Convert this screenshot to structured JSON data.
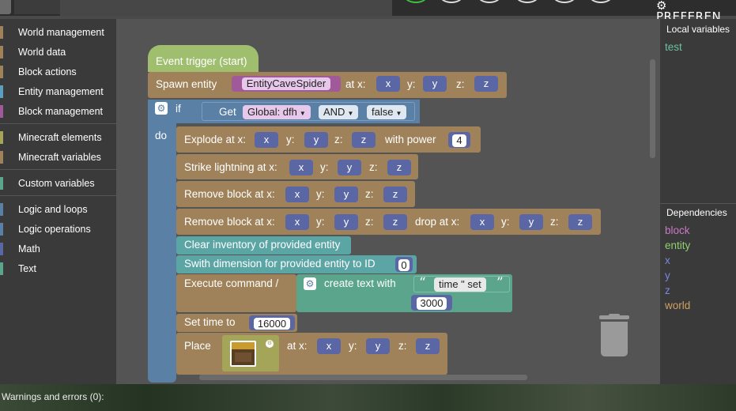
{
  "topbar": {
    "preferences_label": "PREFEREN"
  },
  "palette": {
    "groups": [
      {
        "label": "World management",
        "color": "#a0825a"
      },
      {
        "label": "World data",
        "color": "#a0825a"
      },
      {
        "label": "Block actions",
        "color": "#a0825a"
      },
      {
        "label": "Entity management",
        "color": "#5b9fbf"
      },
      {
        "label": "Block management",
        "color": "#a05a9a"
      },
      {
        "label": "Minecraft elements",
        "color": "#a5a55a"
      },
      {
        "label": "Minecraft variables",
        "color": "#a0825a"
      },
      {
        "label": "Custom variables",
        "color": "#5ba58c"
      },
      {
        "label": "Logic and loops",
        "color": "#5b80a5"
      },
      {
        "label": "Logic operations",
        "color": "#5b80a5"
      },
      {
        "label": "Math",
        "color": "#5b67a5"
      },
      {
        "label": "Text",
        "color": "#5ba58c"
      }
    ]
  },
  "colors": {
    "event": "#9fbf6f",
    "world": "#a0825a",
    "logic": "#5b80a5",
    "entity": "#5ba5a5",
    "text": "#5ba58c",
    "math": "#5b67a5",
    "mcel": "#a5a55a",
    "bool": "#5b80a5",
    "entitytype": "#a05a9a"
  },
  "blocks": {
    "event": "Event trigger (start)",
    "spawn": {
      "label": "Spawn entity",
      "entity": "EntityCaveSpider",
      "at_x": "at x:",
      "y": "y:",
      "z": "z:",
      "vx": "x",
      "vy": "y",
      "vz": "z"
    },
    "if": {
      "label": "if",
      "get": "Get",
      "global": "Global: dfh",
      "and": "AND",
      "false": "false",
      "do": "do"
    },
    "explode": {
      "label": "Explode at x:",
      "y": "y:",
      "z": "z:",
      "with_power": "with power",
      "power": "4",
      "vx": "x",
      "vy": "y",
      "vz": "z"
    },
    "strike": {
      "label": "Strike lightning at x:",
      "y": "y:",
      "z": "z:",
      "vx": "x",
      "vy": "y",
      "vz": "z"
    },
    "remove1": {
      "label": "Remove block at x:",
      "y": "y:",
      "z": "z:",
      "vx": "x",
      "vy": "y",
      "vz": "z"
    },
    "remove2": {
      "label": "Remove block at x:",
      "y": "y:",
      "z": "z:",
      "drop": "drop at x:",
      "y2": "y:",
      "z2": "z:",
      "vx": "x",
      "vy": "y",
      "vz": "z",
      "vx2": "x",
      "vy2": "y",
      "vz2": "z"
    },
    "clear": "Clear inventory of provided entity",
    "dimension": {
      "label": "Swith dimension for provided entity to ID",
      "value": "0"
    },
    "execute": {
      "label": "Execute command /",
      "create_text": "create text with",
      "text_value": "time \" set",
      "num": "3000"
    },
    "settime": {
      "label": "Set time to",
      "value": "16000"
    },
    "place": {
      "label": "Place",
      "at_x": "at x:",
      "y": "y:",
      "z": "z:",
      "vx": "x",
      "vy": "y",
      "vz": "z"
    }
  },
  "right": {
    "local_title": "Local variables",
    "locals": [
      {
        "name": "test",
        "color": "#6fbf9f"
      }
    ],
    "deps_title": "Dependencies",
    "deps": [
      {
        "name": "block",
        "color": "#c879c8"
      },
      {
        "name": "entity",
        "color": "#8fcf6f"
      },
      {
        "name": "x",
        "color": "#7a88e0"
      },
      {
        "name": "y",
        "color": "#7a88e0"
      },
      {
        "name": "z",
        "color": "#7a88e0"
      },
      {
        "name": "world",
        "color": "#d0a060"
      }
    ]
  },
  "status": {
    "warnings": "Warnings and errors (0):"
  }
}
